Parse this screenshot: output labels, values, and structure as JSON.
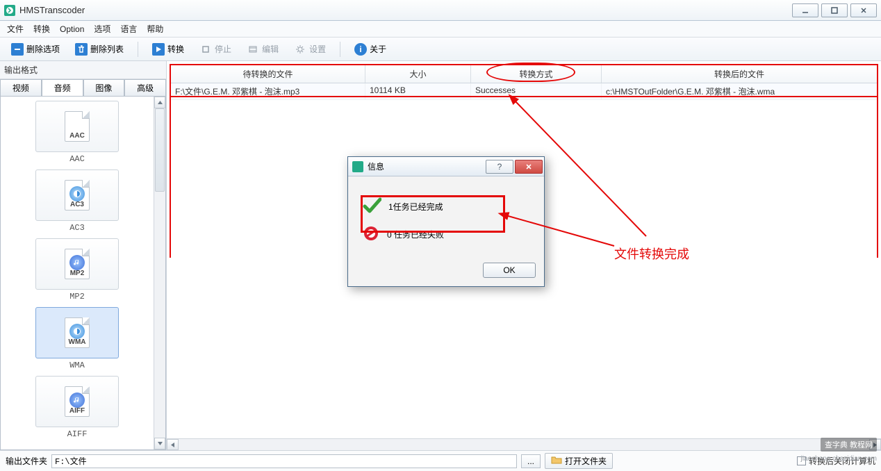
{
  "window": {
    "title": "HMSTranscoder"
  },
  "menu": {
    "items": [
      "文件",
      "转换",
      "Option",
      "选项",
      "语言",
      "帮助"
    ]
  },
  "toolbar": {
    "delete_sel": "删除选项",
    "delete_list": "删除列表",
    "convert": "转换",
    "stop": "停止",
    "edit": "编辑",
    "settings": "设置",
    "about": "关于"
  },
  "left": {
    "group_title": "输出格式",
    "tabs": [
      "视频",
      "音频",
      "图像",
      "高级"
    ],
    "active_tab": 1,
    "formats": [
      {
        "code": "AAC",
        "label": "AAC",
        "kind": "plain"
      },
      {
        "code": "AC3",
        "label": "AC3",
        "kind": "qt"
      },
      {
        "code": "MP2",
        "label": "MP2",
        "kind": "note"
      },
      {
        "code": "WMA",
        "label": "WMA",
        "kind": "qt",
        "selected": true
      },
      {
        "code": "AIFF",
        "label": "AIFF",
        "kind": "note"
      }
    ]
  },
  "list": {
    "headers": [
      "待转换的文件",
      "大小",
      "转换方式",
      "转换后的文件"
    ],
    "rows": [
      {
        "file": "F:\\文件\\G.E.M. 邓紫棋 - 泡沫.mp3",
        "size": "10114 KB",
        "mode": "Successes",
        "out": "c:\\HMSTOutFolder\\G.E.M. 邓紫棋 - 泡沫.wma"
      }
    ]
  },
  "output": {
    "label": "输出文件夹",
    "path": "F:\\文件",
    "browse": "...",
    "open": "打开文件夹",
    "shutdown": "转换后关闭计算机"
  },
  "dialog": {
    "title": "信息",
    "done_line": "1任务已经完成",
    "fail_line": "0 任务已经失败",
    "ok": "OK"
  },
  "annotations": {
    "label": "文件转换完成"
  },
  "watermark": {
    "main": "查字典 教程网",
    "sub": "jiaocheng.chazidian.com"
  }
}
